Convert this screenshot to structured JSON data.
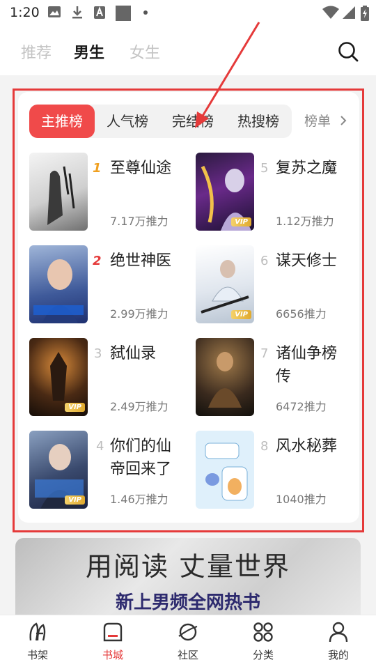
{
  "status_bar": {
    "time": "1:20"
  },
  "header": {
    "tabs": [
      {
        "label": "推荐",
        "active": false
      },
      {
        "label": "男生",
        "active": true
      },
      {
        "label": "女生",
        "active": false
      }
    ],
    "search_icon": "search-icon"
  },
  "ranking": {
    "tabs": [
      {
        "label": "主推榜",
        "active": true
      },
      {
        "label": "人气榜",
        "active": false
      },
      {
        "label": "完结榜",
        "active": false
      },
      {
        "label": "热搜榜",
        "active": false
      }
    ],
    "more_label": "榜单",
    "books": [
      {
        "rank": "1",
        "title": "至尊仙途",
        "votes": "7.17万推力",
        "vip": false
      },
      {
        "rank": "2",
        "title": "绝世神医",
        "votes": "2.99万推力",
        "vip": false
      },
      {
        "rank": "3",
        "title": "弑仙录",
        "votes": "2.49万推力",
        "vip": true
      },
      {
        "rank": "4",
        "title": "你们的仙帝回来了",
        "votes": "1.46万推力",
        "vip": true
      },
      {
        "rank": "5",
        "title": "复苏之魔",
        "votes": "1.12万推力",
        "vip": true
      },
      {
        "rank": "6",
        "title": "谋天修士",
        "votes": "6656推力",
        "vip": true
      },
      {
        "rank": "7",
        "title": "诸仙争榜传",
        "votes": "6472推力",
        "vip": false
      },
      {
        "rank": "8",
        "title": "风水秘葬",
        "votes": "1040推力",
        "vip": false
      }
    ],
    "vip_label": "VIP"
  },
  "banner": {
    "line1": "用阅读 丈量世界",
    "line2": "新上男频全网热书"
  },
  "bottom_nav": [
    {
      "label": "书架",
      "icon": "bookshelf-icon",
      "active": false
    },
    {
      "label": "书城",
      "icon": "bookstore-icon",
      "active": true
    },
    {
      "label": "社区",
      "icon": "planet-icon",
      "active": false
    },
    {
      "label": "分类",
      "icon": "category-icon",
      "active": false
    },
    {
      "label": "我的",
      "icon": "profile-icon",
      "active": false
    }
  ],
  "colors": {
    "accent": "#f04a4a",
    "highlight_box": "#e53a3a",
    "rank_top": "#f0a020"
  }
}
